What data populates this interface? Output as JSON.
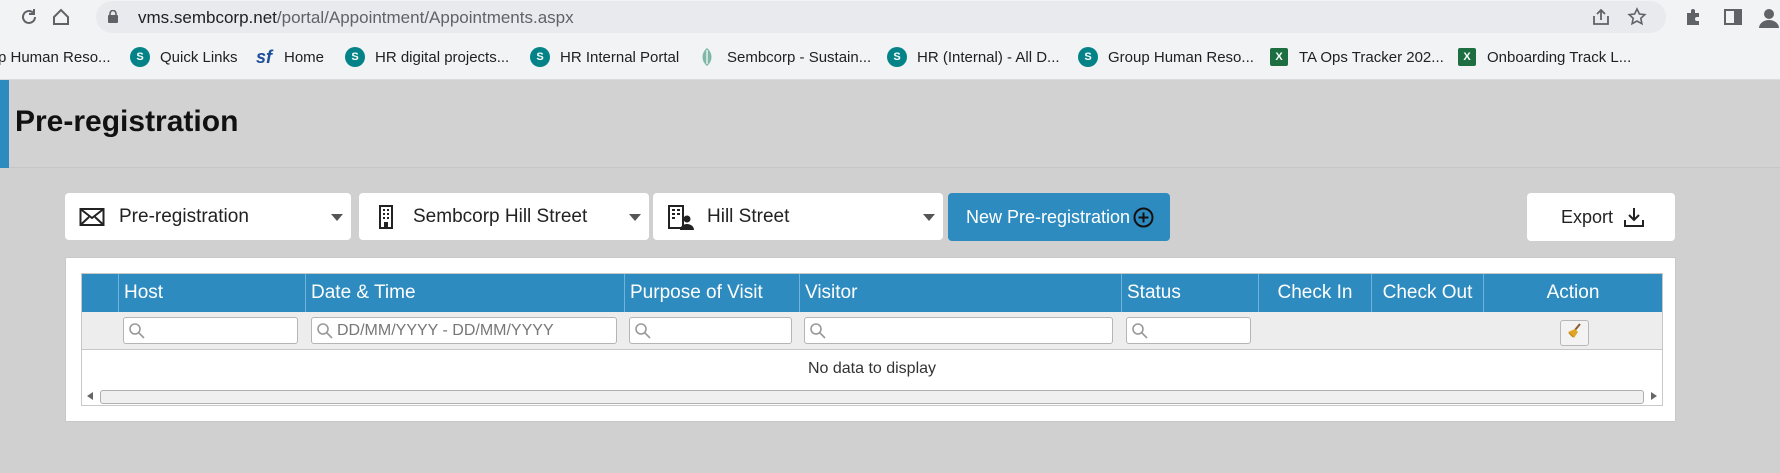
{
  "browser": {
    "url_domain": "vms.sembcorp.net",
    "url_path": "/portal/Appointment/Appointments.aspx"
  },
  "bookmarks": [
    {
      "label": "p Human Reso...",
      "icon": "sharepoint-icon"
    },
    {
      "label": "Quick Links",
      "icon": "sharepoint-icon"
    },
    {
      "label": "Home",
      "icon": "successfactors-icon"
    },
    {
      "label": "HR digital projects...",
      "icon": "sharepoint-icon"
    },
    {
      "label": "HR Internal Portal",
      "icon": "sharepoint-icon"
    },
    {
      "label": "Sembcorp - Sustain...",
      "icon": "sembcorp-leaf-icon"
    },
    {
      "label": "HR (Internal) - All D...",
      "icon": "sharepoint-icon"
    },
    {
      "label": "Group Human Reso...",
      "icon": "sharepoint-icon"
    },
    {
      "label": "TA Ops Tracker 202...",
      "icon": "excel-icon"
    },
    {
      "label": "Onboarding Track L...",
      "icon": "excel-icon"
    }
  ],
  "page": {
    "title": "Pre-registration",
    "accent_color": "#2e8bc0"
  },
  "toolbar": {
    "type_select": "Pre-registration",
    "company_select": "Sembcorp Hill Street",
    "location_select": "Hill Street",
    "new_button": "New Pre-registration",
    "export_button": "Export"
  },
  "grid": {
    "columns": [
      "Host",
      "Date & Time",
      "Purpose of Visit",
      "Visitor",
      "Status",
      "Check In",
      "Check Out",
      "Action"
    ],
    "date_filter_placeholder": "DD/MM/YYYY - DD/MM/YYYY",
    "empty_text": "No data to display"
  }
}
